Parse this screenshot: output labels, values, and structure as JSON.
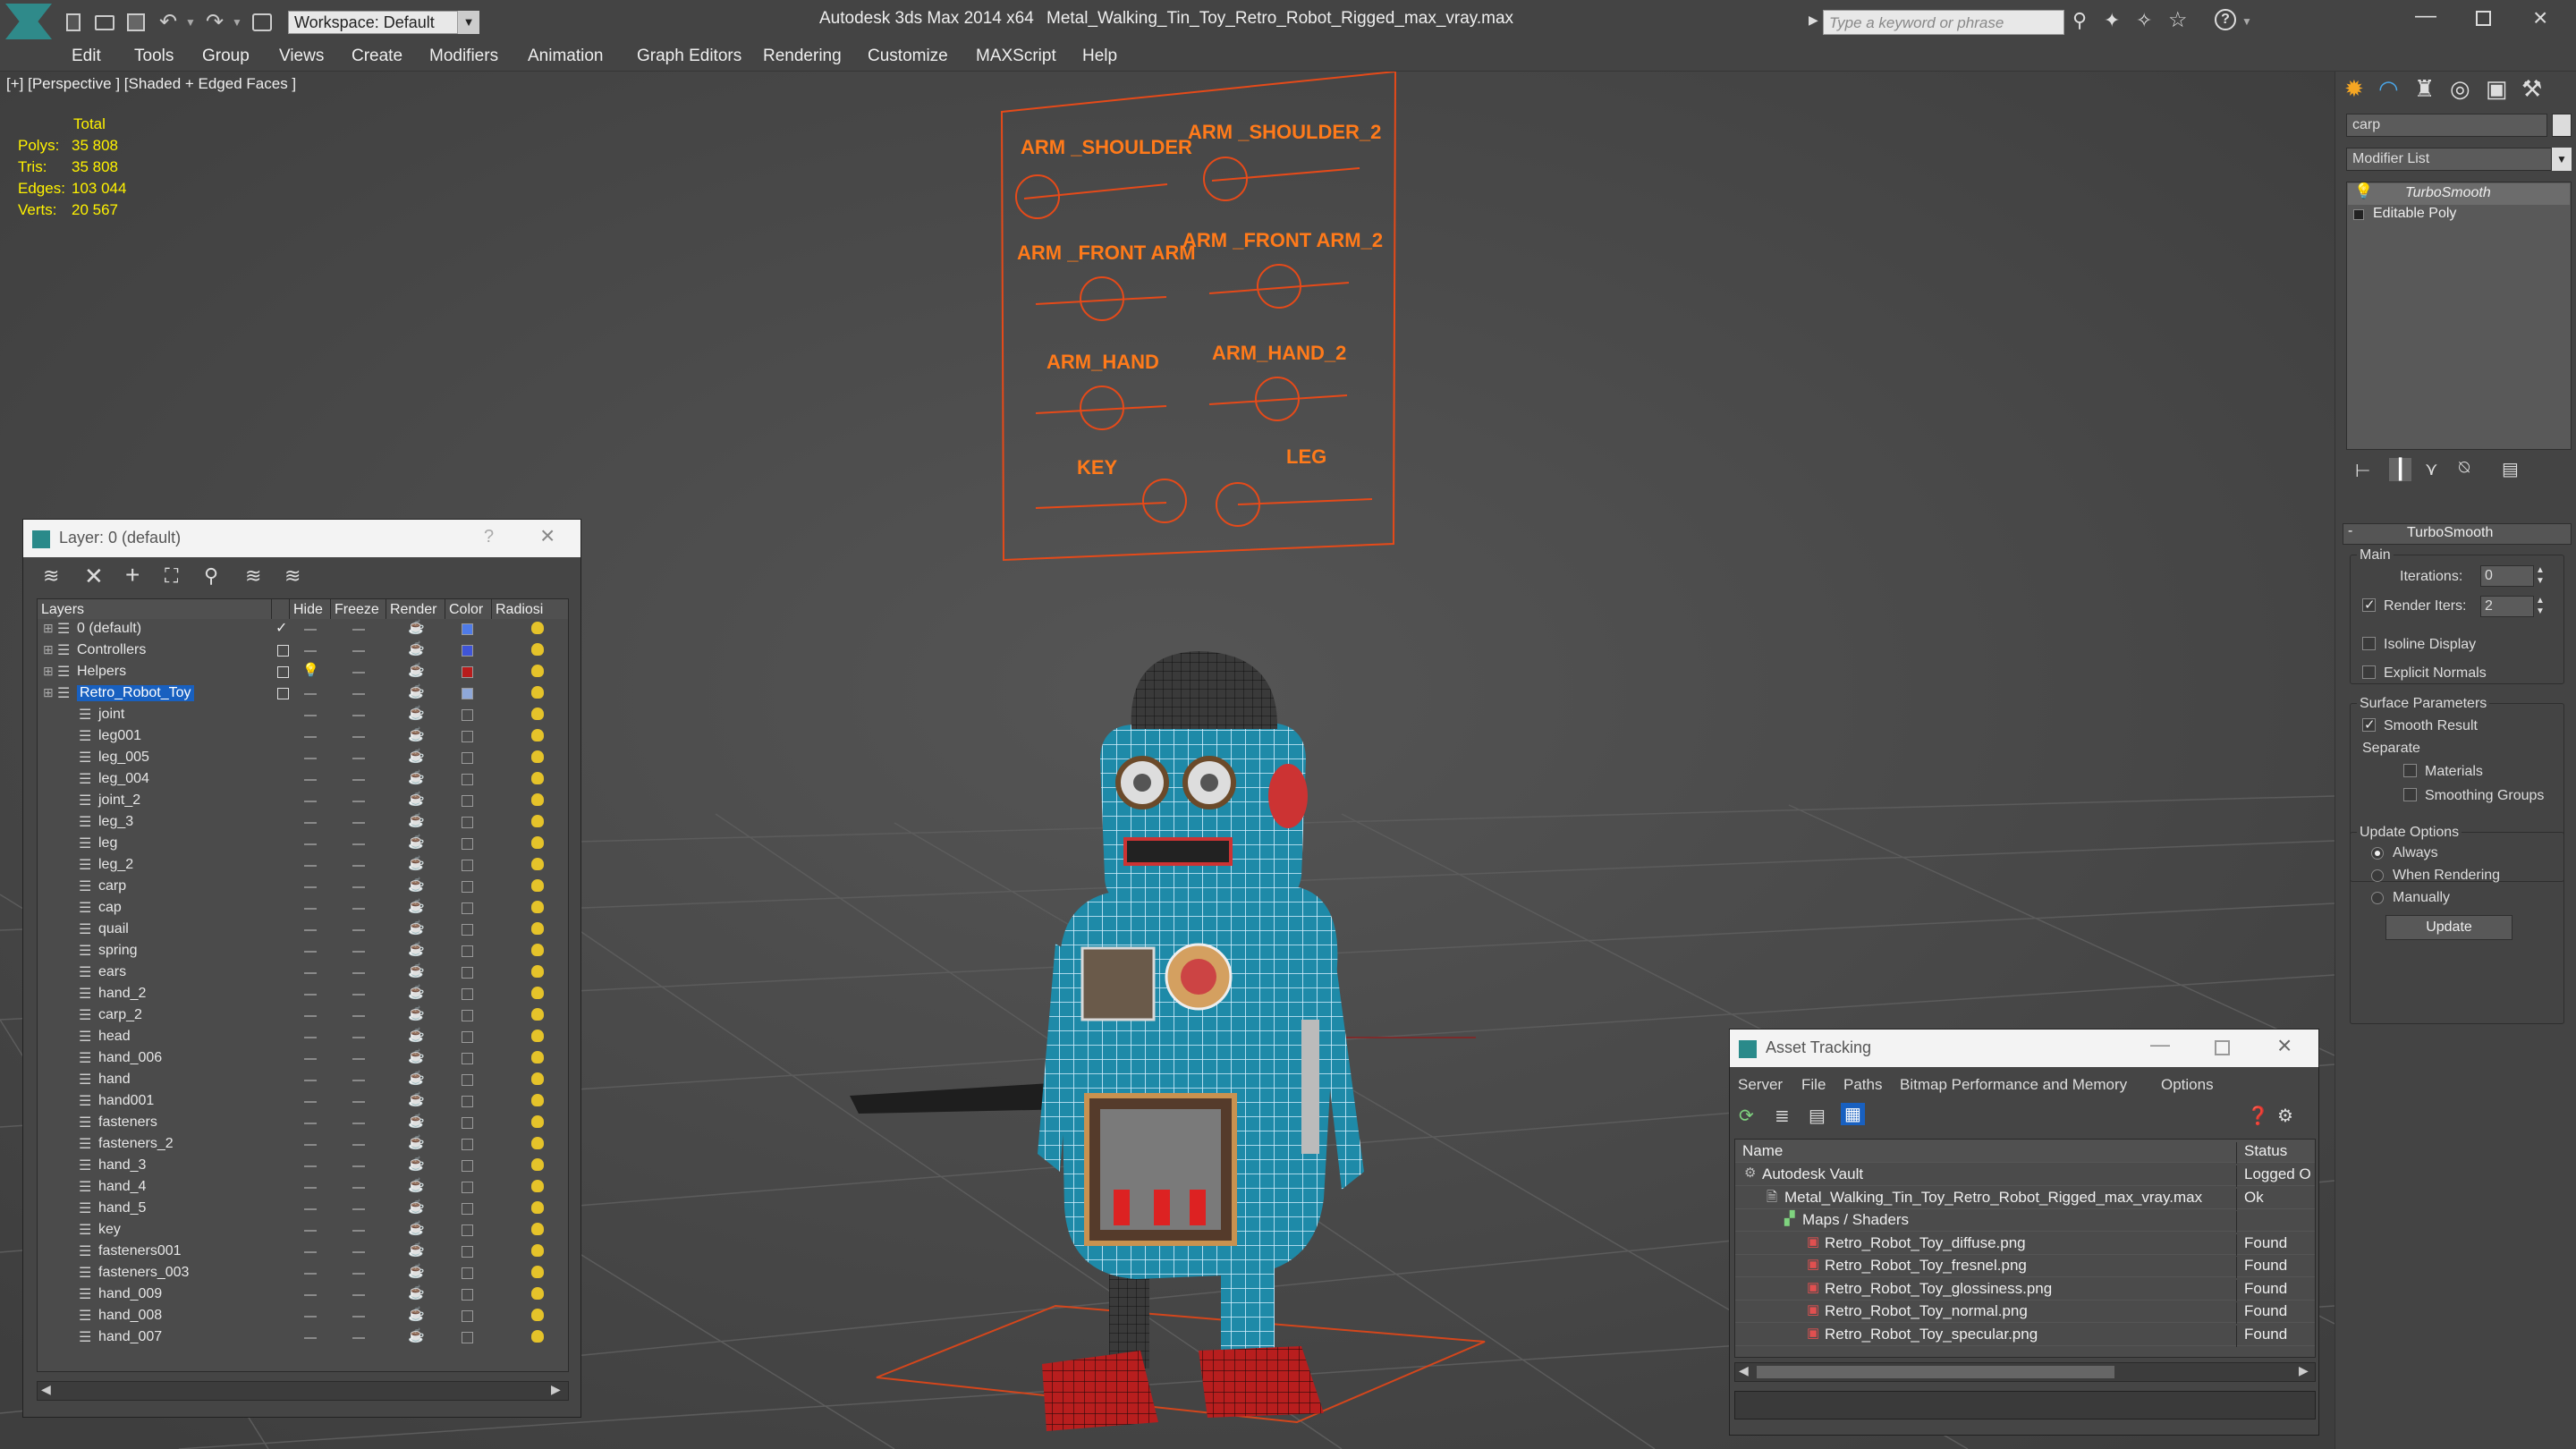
{
  "app": {
    "title": "Autodesk 3ds Max  2014 x64",
    "file": "Metal_Walking_Tin_Toy_Retro_Robot_Rigged_max_vray.max",
    "workspace": "Workspace: Default",
    "search_placeholder": "Type a keyword or phrase"
  },
  "menu": [
    "Edit",
    "Tools",
    "Group",
    "Views",
    "Create",
    "Modifiers",
    "Animation",
    "Graph Editors",
    "Rendering",
    "Customize",
    "MAXScript",
    "Help"
  ],
  "viewport": {
    "label": "[+] [Perspective ] [Shaded + Edged Faces ]",
    "stats": {
      "header": "Total",
      "rows": [
        {
          "label": "Polys:",
          "value": "35 808"
        },
        {
          "label": "Tris:",
          "value": "35 808"
        },
        {
          "label": "Edges:",
          "value": "103 044"
        },
        {
          "label": "Verts:",
          "value": "20 567"
        }
      ]
    },
    "rig_panel": {
      "labels": [
        "ARM _SHOULDER",
        "ARM _SHOULDER_2",
        "ARM _FRONT ARM",
        "ARM _FRONT ARM_2",
        "ARM_HAND",
        "ARM_HAND_2",
        "KEY",
        "LEG"
      ]
    }
  },
  "cmd_panel": {
    "object_name": "carp",
    "modifier_list": "Modifier List",
    "stack": [
      "TurboSmooth",
      "Editable Poly"
    ],
    "rollout_title": "TurboSmooth",
    "main": "Main",
    "iterations_label": "Iterations:",
    "iterations_value": "0",
    "render_iters_label": "Render Iters:",
    "render_iters_value": "2",
    "isoline": "Isoline Display",
    "explicit": "Explicit Normals",
    "surface": "Surface Parameters",
    "smooth_result": "Smooth Result",
    "separate": "Separate",
    "materials": "Materials",
    "smoothing_groups": "Smoothing Groups",
    "update_options": "Update Options",
    "always": "Always",
    "when_rendering": "When Rendering",
    "manually": "Manually",
    "update_button": "Update"
  },
  "layer_window": {
    "title": "Layer: 0 (default)",
    "help": "?",
    "columns": [
      "Layers",
      "Hide",
      "Freeze",
      "Render",
      "Color",
      "Radiosi"
    ],
    "rows": [
      {
        "name": "0 (default)",
        "level": 0,
        "color": "#4f7be8"
      },
      {
        "name": "Controllers",
        "level": 0,
        "color": "#3f55d8"
      },
      {
        "name": "Helpers",
        "level": 0,
        "color": "#b81c1c"
      },
      {
        "name": "Retro_Robot_Toy",
        "level": 0,
        "color": "#8fa8d8",
        "selected": true
      },
      {
        "name": "joint",
        "level": 1
      },
      {
        "name": "leg001",
        "level": 1
      },
      {
        "name": "leg_005",
        "level": 1
      },
      {
        "name": "leg_004",
        "level": 1
      },
      {
        "name": "joint_2",
        "level": 1
      },
      {
        "name": "leg_3",
        "level": 1
      },
      {
        "name": "leg",
        "level": 1
      },
      {
        "name": "leg_2",
        "level": 1
      },
      {
        "name": "carp",
        "level": 1
      },
      {
        "name": "cap",
        "level": 1
      },
      {
        "name": "quail",
        "level": 1
      },
      {
        "name": "spring",
        "level": 1
      },
      {
        "name": "ears",
        "level": 1
      },
      {
        "name": "hand_2",
        "level": 1
      },
      {
        "name": "carp_2",
        "level": 1
      },
      {
        "name": "head",
        "level": 1
      },
      {
        "name": "hand_006",
        "level": 1
      },
      {
        "name": "hand",
        "level": 1
      },
      {
        "name": "hand001",
        "level": 1
      },
      {
        "name": "fasteners",
        "level": 1
      },
      {
        "name": "fasteners_2",
        "level": 1
      },
      {
        "name": "hand_3",
        "level": 1
      },
      {
        "name": "hand_4",
        "level": 1
      },
      {
        "name": "hand_5",
        "level": 1
      },
      {
        "name": "key",
        "level": 1
      },
      {
        "name": "fasteners001",
        "level": 1
      },
      {
        "name": "fasteners_003",
        "level": 1
      },
      {
        "name": "hand_009",
        "level": 1
      },
      {
        "name": "hand_008",
        "level": 1
      },
      {
        "name": "hand_007",
        "level": 1
      }
    ]
  },
  "asset_window": {
    "title": "Asset Tracking",
    "menu": [
      "Server",
      "File",
      "Paths",
      "Bitmap Performance and Memory",
      "Options"
    ],
    "columns": [
      "Name",
      "Status"
    ],
    "rows": [
      {
        "name": "Autodesk Vault",
        "status": "Logged O",
        "level": 0
      },
      {
        "name": "Metal_Walking_Tin_Toy_Retro_Robot_Rigged_max_vray.max",
        "status": "Ok",
        "level": 1
      },
      {
        "name": "Maps / Shaders",
        "status": "",
        "level": 2
      },
      {
        "name": "Retro_Robot_Toy_diffuse.png",
        "status": "Found",
        "level": 3
      },
      {
        "name": "Retro_Robot_Toy_fresnel.png",
        "status": "Found",
        "level": 3
      },
      {
        "name": "Retro_Robot_Toy_glossiness.png",
        "status": "Found",
        "level": 3
      },
      {
        "name": "Retro_Robot_Toy_normal.png",
        "status": "Found",
        "level": 3
      },
      {
        "name": "Retro_Robot_Toy_specular.png",
        "status": "Found",
        "level": 3
      }
    ]
  },
  "colors": {
    "accent": "#ff6a1a",
    "selection": "#1860c0",
    "robot": "#1e8aa8",
    "feet": "#c32222"
  }
}
